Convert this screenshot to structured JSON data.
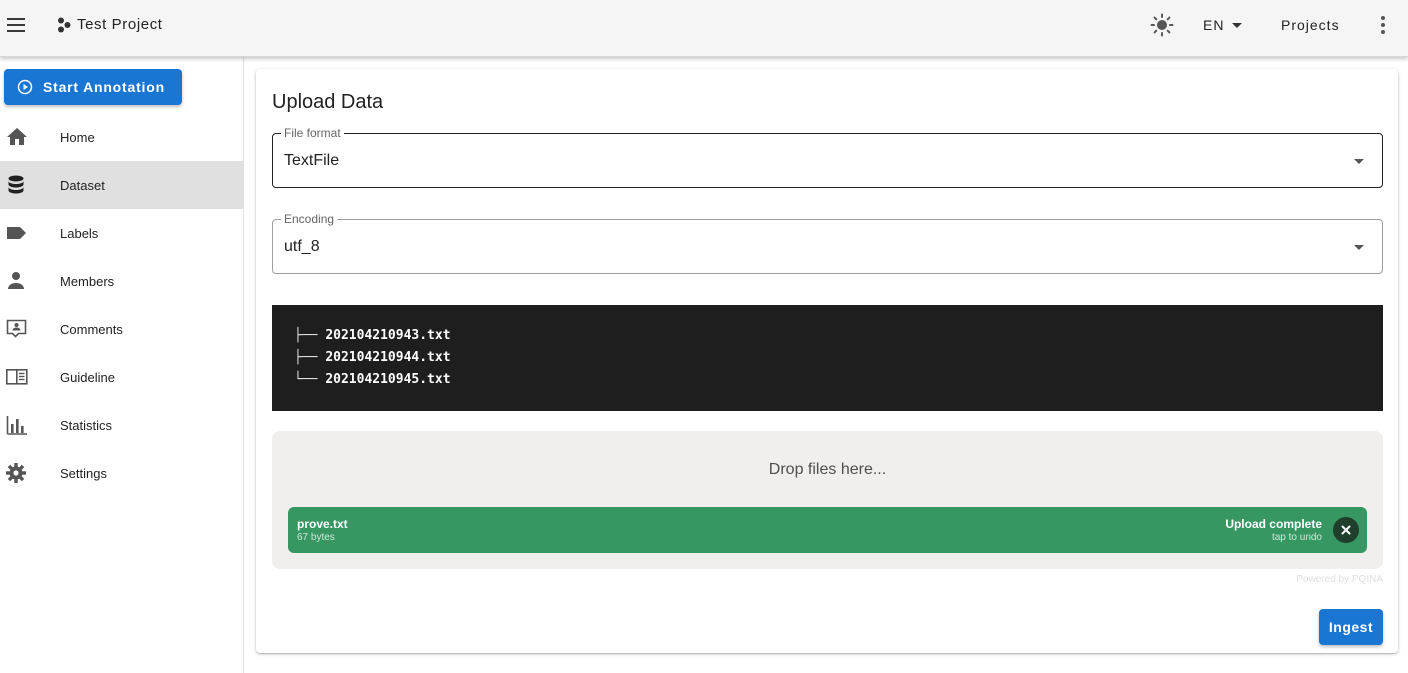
{
  "appbar": {
    "title": "Test Project",
    "language": "EN",
    "projects_label": "Projects",
    "icons": {
      "menu": "hamburger-menu-icon",
      "brand": "project-brand-icon",
      "theme": "brightness-icon",
      "more": "dots-vertical-icon"
    }
  },
  "sidebar": {
    "start_button": "Start Annotation",
    "items": [
      {
        "label": "Home",
        "icon": "home-icon",
        "active": false
      },
      {
        "label": "Dataset",
        "icon": "database-icon",
        "active": true
      },
      {
        "label": "Labels",
        "icon": "label-icon",
        "active": false
      },
      {
        "label": "Members",
        "icon": "account-icon",
        "active": false
      },
      {
        "label": "Comments",
        "icon": "comment-account-icon",
        "active": false
      },
      {
        "label": "Guideline",
        "icon": "book-open-icon",
        "active": false
      },
      {
        "label": "Statistics",
        "icon": "chart-bar-icon",
        "active": false
      },
      {
        "label": "Settings",
        "icon": "cog-icon",
        "active": false
      }
    ]
  },
  "main": {
    "title": "Upload Data",
    "file_format": {
      "label": "File format",
      "value": "TextFile"
    },
    "encoding": {
      "label": "Encoding",
      "value": "utf_8"
    },
    "example_tree": [
      {
        "prefix": "├── ",
        "name": "202104210943.txt"
      },
      {
        "prefix": "├── ",
        "name": "202104210944.txt"
      },
      {
        "prefix": "└── ",
        "name": "202104210945.txt"
      }
    ],
    "dropzone": {
      "label": "Drop files here...",
      "file": {
        "name": "prove.txt",
        "size": "67 bytes",
        "status": "Upload complete",
        "undo_hint": "tap to undo"
      },
      "powered_by": "Powered by PQINA"
    },
    "ingest_button": "Ingest"
  },
  "colors": {
    "primary": "#1976d2",
    "appbar_bg": "#f5f5f5",
    "code_bg": "#1e1e1e",
    "upload_success": "#369763",
    "active_nav_bg": "#e0e0e0"
  }
}
